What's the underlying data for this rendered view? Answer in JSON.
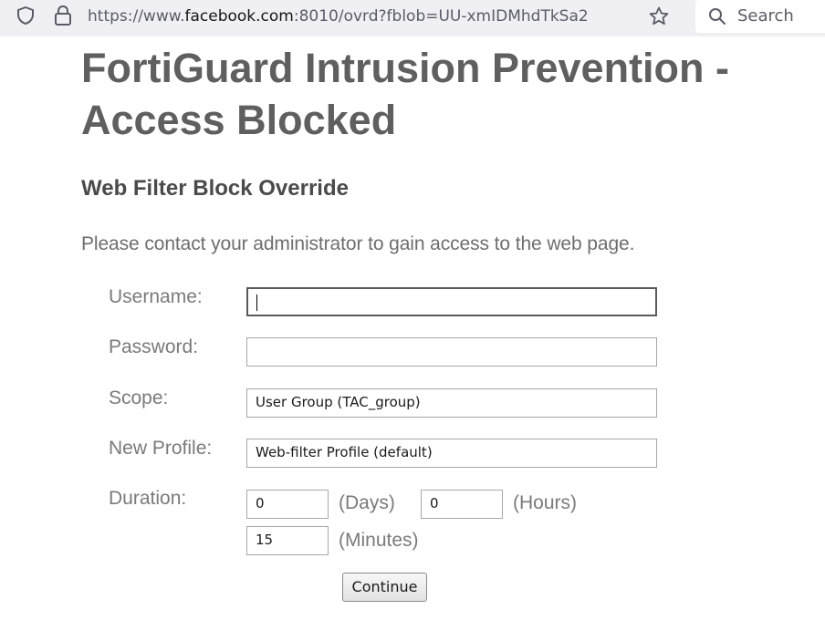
{
  "browser": {
    "url_prefix": "https://www.",
    "url_domain": "facebook.com",
    "url_suffix": ":8010/ovrd?fblob=UU-xmIDMhdTkSa2",
    "search_placeholder": "Search"
  },
  "page": {
    "title": "FortiGuard Intrusion Prevention - Access Blocked",
    "subtitle": "Web Filter Block Override",
    "message": "Please contact your administrator to gain access to the web page."
  },
  "form": {
    "username_label": "Username:",
    "username_value": "",
    "password_label": "Password:",
    "password_value": "",
    "scope_label": "Scope:",
    "scope_value": "User Group (TAC_group)",
    "profile_label": "New Profile:",
    "profile_value": "Web-filter Profile (default)",
    "duration_label": "Duration:",
    "days_value": "0",
    "days_unit": "(Days)",
    "hours_value": "0",
    "hours_unit": "(Hours)",
    "minutes_value": "15",
    "minutes_unit": "(Minutes)",
    "continue_label": "Continue"
  }
}
